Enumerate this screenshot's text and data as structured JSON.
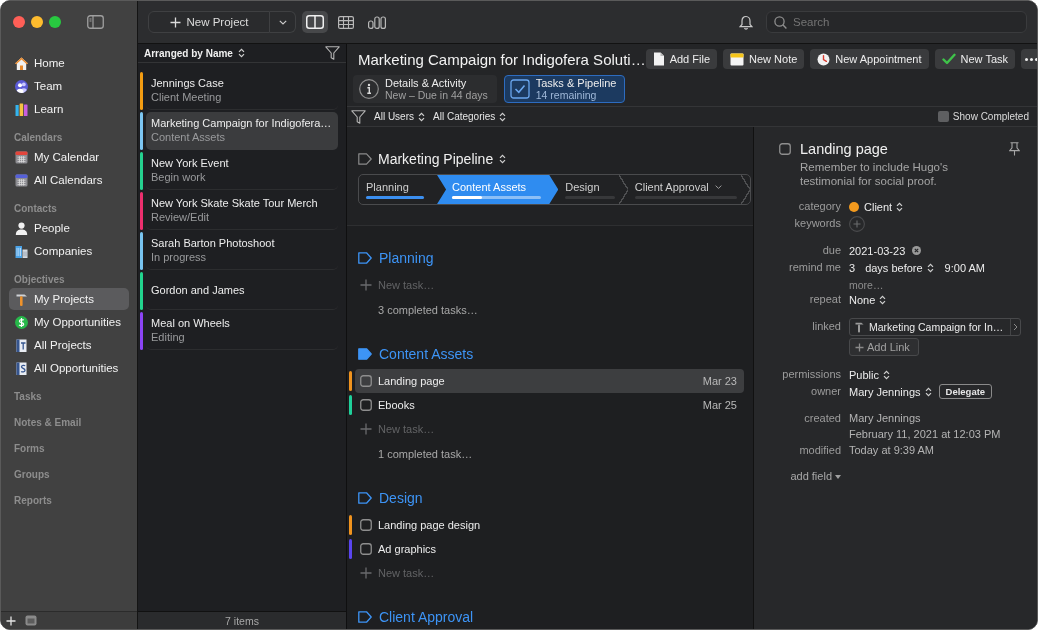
{
  "sidebar": {
    "sections": [
      {
        "items": [
          {
            "label": "Home",
            "selected": false
          },
          {
            "label": "Team",
            "selected": false
          },
          {
            "label": "Learn",
            "selected": false
          }
        ]
      },
      {
        "heading": "Calendars",
        "items": [
          {
            "label": "My Calendar",
            "selected": false
          },
          {
            "label": "All Calendars",
            "selected": false
          }
        ]
      },
      {
        "heading": "Contacts",
        "items": [
          {
            "label": "People",
            "selected": false
          },
          {
            "label": "Companies",
            "selected": false
          }
        ]
      },
      {
        "heading": "Objectives",
        "items": [
          {
            "label": "My Projects",
            "selected": true
          },
          {
            "label": "My Opportunities",
            "selected": false
          },
          {
            "label": "All Projects",
            "selected": false
          },
          {
            "label": "All Opportunities",
            "selected": false
          }
        ]
      },
      {
        "heading": "Tasks"
      },
      {
        "heading": "Notes & Email"
      },
      {
        "heading": "Forms"
      },
      {
        "heading": "Groups"
      },
      {
        "heading": "Reports"
      }
    ]
  },
  "toolbar": {
    "new_button": "New Project",
    "views": [
      {
        "selected": true
      },
      {
        "selected": false
      },
      {
        "selected": false
      }
    ],
    "search": {
      "placeholder": "Search"
    }
  },
  "project_list": {
    "sort": "Arranged by Name",
    "items": [
      {
        "title": "Jennings Case",
        "subtitle": "Client Meeting",
        "color": "#f39c12",
        "selected": false
      },
      {
        "title": "Marketing Campaign for Indigofera…",
        "subtitle": "Content Assets",
        "color": "#7cc6f2",
        "selected": true
      },
      {
        "title": "New York Event",
        "subtitle": "Begin work",
        "color": "#25d08f",
        "selected": false
      },
      {
        "title": "New York Skate Skate Tour Merch",
        "subtitle": "Review/Edit",
        "color": "#ec2f6e",
        "selected": false
      },
      {
        "title": "Sarah Barton Photoshoot",
        "subtitle": "In progress",
        "color": "#78c4f0",
        "selected": false
      },
      {
        "title": "Gordon and James",
        "color": "#22d48e",
        "selected": false
      },
      {
        "title": "Meal on Wheels",
        "subtitle": "Editing",
        "color": "#8b44f5",
        "selected": false
      }
    ],
    "footer": "7 items"
  },
  "project": {
    "title": "Marketing Campaign for Indigofera Soluti…",
    "actions": [
      "Add File",
      "New Note",
      "New Appointment",
      "New Task"
    ],
    "tabs": [
      {
        "title": "Details & Activity",
        "subtitle": "New – Due in 44 days",
        "selected": false
      },
      {
        "title": "Tasks & Pipeline",
        "subtitle": "14 remaining",
        "selected": true
      }
    ]
  },
  "filters": {
    "users": "All Users",
    "categories": "All Categories",
    "show_completed": {
      "label": "Show Completed",
      "checked": false
    }
  },
  "pipeline": {
    "name": "Marketing Pipeline",
    "stages": [
      {
        "label": "Planning",
        "selected": false,
        "menu": false,
        "level": 1
      },
      {
        "label": "Content Assets",
        "selected": true,
        "menu": false,
        "level": 0.33
      },
      {
        "label": "Design",
        "selected": false,
        "menu": false,
        "level": 0
      },
      {
        "label": "Client Approval",
        "selected": false,
        "menu": true,
        "level": 0
      }
    ],
    "sections": [
      {
        "title": "Planning",
        "current": false,
        "new_task": "New task…",
        "completed": "3 completed tasks…"
      },
      {
        "title": "Content Assets",
        "current": true,
        "tasks": [
          {
            "title": "Landing page",
            "due": "Mar 23",
            "color": "#f0931e",
            "checked": false,
            "selected": true
          },
          {
            "title": "Ebooks",
            "due": "Mar 25",
            "color": "#1fd09a",
            "checked": false,
            "selected": false
          }
        ],
        "new_task": "New task…",
        "completed": "1 completed task…"
      },
      {
        "title": "Design",
        "current": false,
        "tasks": [
          {
            "title": "Landing page design",
            "color": "#f0931e",
            "checked": false,
            "selected": false
          },
          {
            "title": "Ad graphics",
            "color": "#5a45f0",
            "checked": false,
            "selected": false
          }
        ],
        "new_task": "New task…"
      },
      {
        "title": "Client Approval",
        "current": false
      }
    ]
  },
  "task_detail": {
    "title": "Landing page",
    "checked": false,
    "notes": "Remember to include Hugo's testimonial for social proof.",
    "groups": [
      {
        "fields": [
          {
            "kind": "category",
            "label": "category",
            "value": "Client",
            "color": "#f39a1e"
          },
          {
            "kind": "add",
            "label": "keywords"
          }
        ]
      },
      {
        "fields": [
          {
            "kind": "date",
            "label": "due",
            "value": "2021-03-23"
          },
          {
            "kind": "reminder",
            "label": "remind me",
            "count": "3",
            "unit": "days before",
            "time": "9:00 AM",
            "more": "more…"
          },
          {
            "kind": "popup",
            "label": "repeat",
            "value": "None"
          }
        ]
      },
      {
        "fields": [
          {
            "kind": "link",
            "label": "linked",
            "value": "Marketing Campaign for In…",
            "button": "Add Link"
          }
        ]
      },
      {
        "fields": [
          {
            "kind": "popup",
            "label": "permissions",
            "value": "Public"
          },
          {
            "kind": "owner",
            "label": "owner",
            "value": "Mary Jennings",
            "button": "Delegate"
          }
        ]
      },
      {
        "fields": [
          {
            "kind": "text",
            "label": "created",
            "lines": [
              "Mary Jennings",
              "February 11, 2021 at 12:03 PM"
            ]
          },
          {
            "kind": "text",
            "label": "modified",
            "lines": [
              "Today at 9:39 AM"
            ]
          }
        ]
      }
    ],
    "add_field": "add field"
  }
}
